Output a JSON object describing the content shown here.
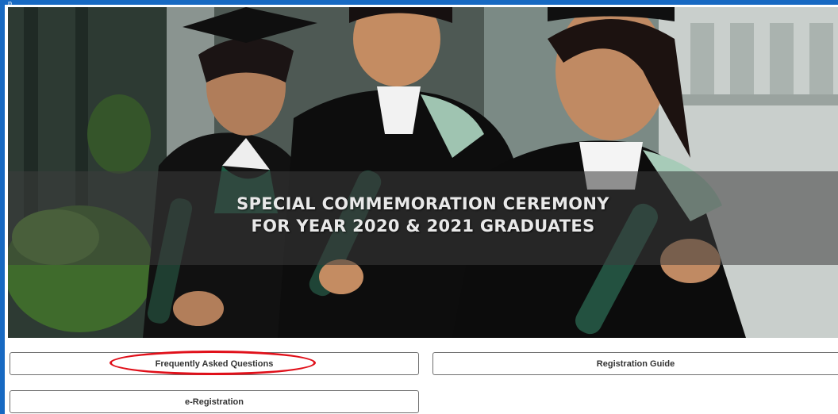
{
  "header": {
    "partial_text": "p"
  },
  "banner": {
    "title_line1": "SPECIAL COMMEMORATION CEREMONY",
    "title_line2": "FOR YEAR 2020 & 2021 GRADUATES"
  },
  "buttons": {
    "faq_label": "Frequently Asked Questions",
    "guide_label": "Registration Guide",
    "ereg_label": "e-Registration"
  },
  "colors": {
    "frame_border": "#1769c2",
    "highlight": "#e0101a",
    "gown_trim": "#1f5a43"
  }
}
